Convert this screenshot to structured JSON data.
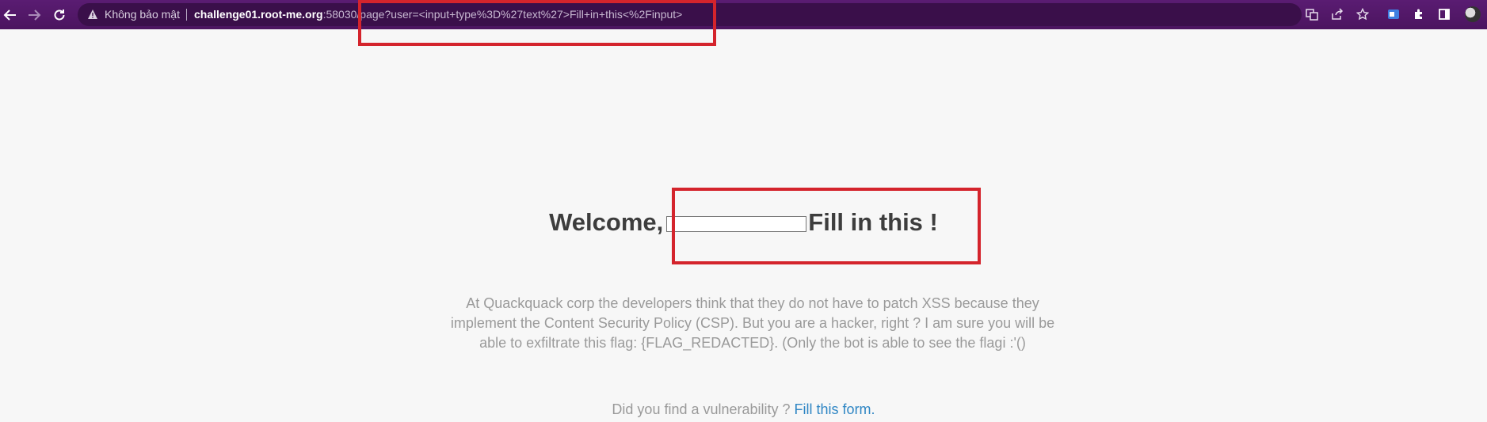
{
  "browser": {
    "security_label": "Không bảo mật",
    "url_host": "challenge01.root-me.org",
    "url_rest": ":58030/page?user=<input+type%3D%27text%27>Fill+in+this<%2Finput>",
    "icons": [
      "back-icon",
      "forward-icon",
      "reload-icon",
      "warning-icon",
      "translate-icon",
      "share-icon",
      "star-icon",
      "extension-icon",
      "puzzle-icon",
      "sidepanel-icon",
      "profile-avatar"
    ]
  },
  "page": {
    "welcome_prefix": "Welcome,",
    "welcome_suffix": "Fill in this !",
    "input_value": "",
    "description": "At Quackquack corp the developers think that they do not have to patch XSS because they implement the Content Security Policy (CSP). But you are a hacker, right ? I am sure you will be able to exfiltrate this flag: {FLAG_REDACTED}. (Only the bot is able to see the flagi :'()",
    "footer_text": "Did you find a vulnerability ? ",
    "footer_link": "Fill this form."
  },
  "colors": {
    "browser_bar": "#4b145f",
    "highlight": "#d4242c",
    "link": "#2f86c4",
    "background": "#f7f7f7"
  }
}
